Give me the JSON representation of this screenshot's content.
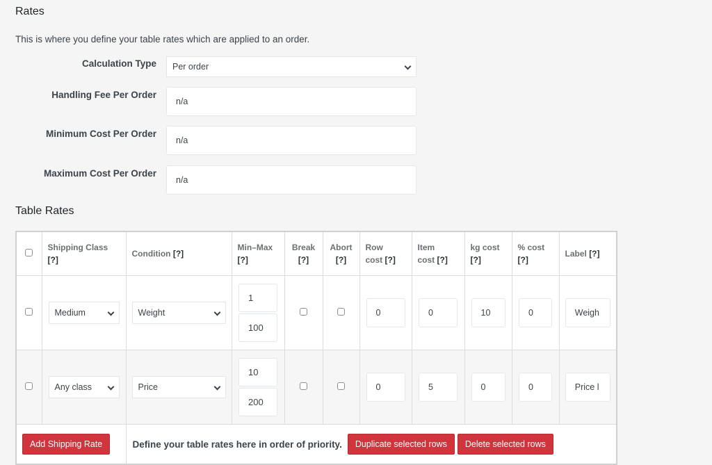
{
  "page": {
    "title": "Rates",
    "description": "This is where you define your table rates which are applied to an order."
  },
  "settings": {
    "calculation_type": {
      "label": "Calculation Type",
      "value": "Per order"
    },
    "handling_fee": {
      "label": "Handling Fee Per Order",
      "placeholder": "n/a"
    },
    "minimum_cost": {
      "label": "Minimum Cost Per Order",
      "placeholder": "n/a"
    },
    "maximum_cost": {
      "label": "Maximum Cost Per Order",
      "placeholder": "n/a"
    }
  },
  "table": {
    "title": "Table Rates",
    "help_marker": "[?]",
    "headers": {
      "shipping_class": "Shipping Class",
      "condition": "Condition",
      "min_max": "Min–Max",
      "break": "Break",
      "abort": "Abort",
      "row_cost_1": "Row",
      "row_cost_2": "cost",
      "item_cost_1": "Item",
      "item_cost_2": "cost",
      "kg_cost": "kg cost",
      "pct_cost": "% cost",
      "label": "Label"
    },
    "rows": [
      {
        "selected": false,
        "shipping_class": "Medium",
        "condition": "Weight",
        "min": "1",
        "max": "100",
        "break": false,
        "abort": false,
        "row_cost": "0",
        "item_cost": "0",
        "kg_cost": "10",
        "pct_cost": "0",
        "label": "Weigh"
      },
      {
        "selected": false,
        "shipping_class": "Any class",
        "condition": "Price",
        "min": "10",
        "max": "200",
        "break": false,
        "abort": false,
        "row_cost": "0",
        "item_cost": "5",
        "kg_cost": "0",
        "pct_cost": "0",
        "label": "Price l"
      }
    ],
    "footer": {
      "add_button": "Add Shipping Rate",
      "hint": "Define your table rates here in order of priority.",
      "duplicate_button": "Duplicate selected rows",
      "delete_button": "Delete selected rows"
    }
  },
  "colors": {
    "accent_red": "#d0343c",
    "background": "#f5f5f5"
  }
}
